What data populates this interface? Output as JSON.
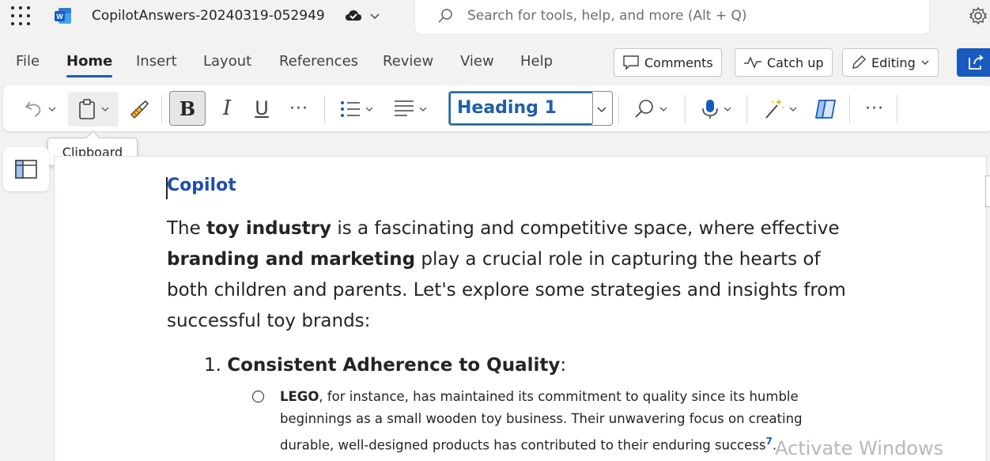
{
  "titlebar": {
    "doc_title": "CopilotAnswers-20240319-052949",
    "search_placeholder": "Search for tools, help, and more (Alt + Q)"
  },
  "menu": {
    "tabs": [
      "File",
      "Home",
      "Insert",
      "Layout",
      "References",
      "Review",
      "View",
      "Help"
    ],
    "active_tab": "Home",
    "comments_label": "Comments",
    "catchup_label": "Catch up",
    "editing_label": "Editing"
  },
  "ribbon": {
    "bold": "B",
    "italic": "I",
    "underline": "U",
    "more": "···",
    "style_value": "Heading 1"
  },
  "tooltip": {
    "text": "Clipboard"
  },
  "document": {
    "heading": "Copilot",
    "para_1": "The ",
    "para_bold_1": "toy industry",
    "para_2": " is a fascinating and competitive space, where effective ",
    "para_bold_2": "branding and marketing",
    "para_3": " play a crucial role in capturing the hearts of both children and parents. Let's explore some strategies and insights from successful toy brands:",
    "list_number": "1.",
    "list_title": "Consistent Adherence to Quality",
    "list_colon": ":",
    "sub_bold": "LEGO",
    "sub_text": ", for instance, has maintained its commitment to quality since its humble beginnings as a small wooden toy business. Their unwavering focus on creating durable, well-designed products has contributed to their enduring success",
    "sub_ref": "7",
    "sub_end": "."
  },
  "watermark": {
    "text": "Activate Windows"
  },
  "colors": {
    "accent": "#185abd",
    "heading": "#1f4fa8"
  }
}
